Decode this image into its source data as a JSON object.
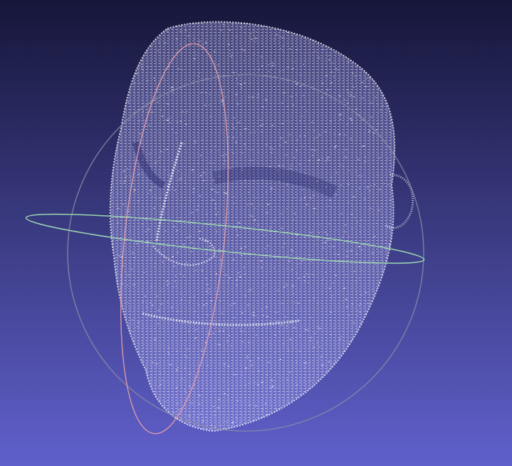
{
  "viewer": {
    "background_top_color": "#16163a",
    "background_bottom_color": "#6060cc",
    "point_color": "#ffffff",
    "trackball": {
      "outer_color": "#8a8aa8",
      "horizontal_ring_color": "#9bd6b0",
      "vertical_ring_color": "#e6a0a8"
    },
    "model": {
      "render_mode": "point-cloud",
      "subject": "face"
    }
  }
}
